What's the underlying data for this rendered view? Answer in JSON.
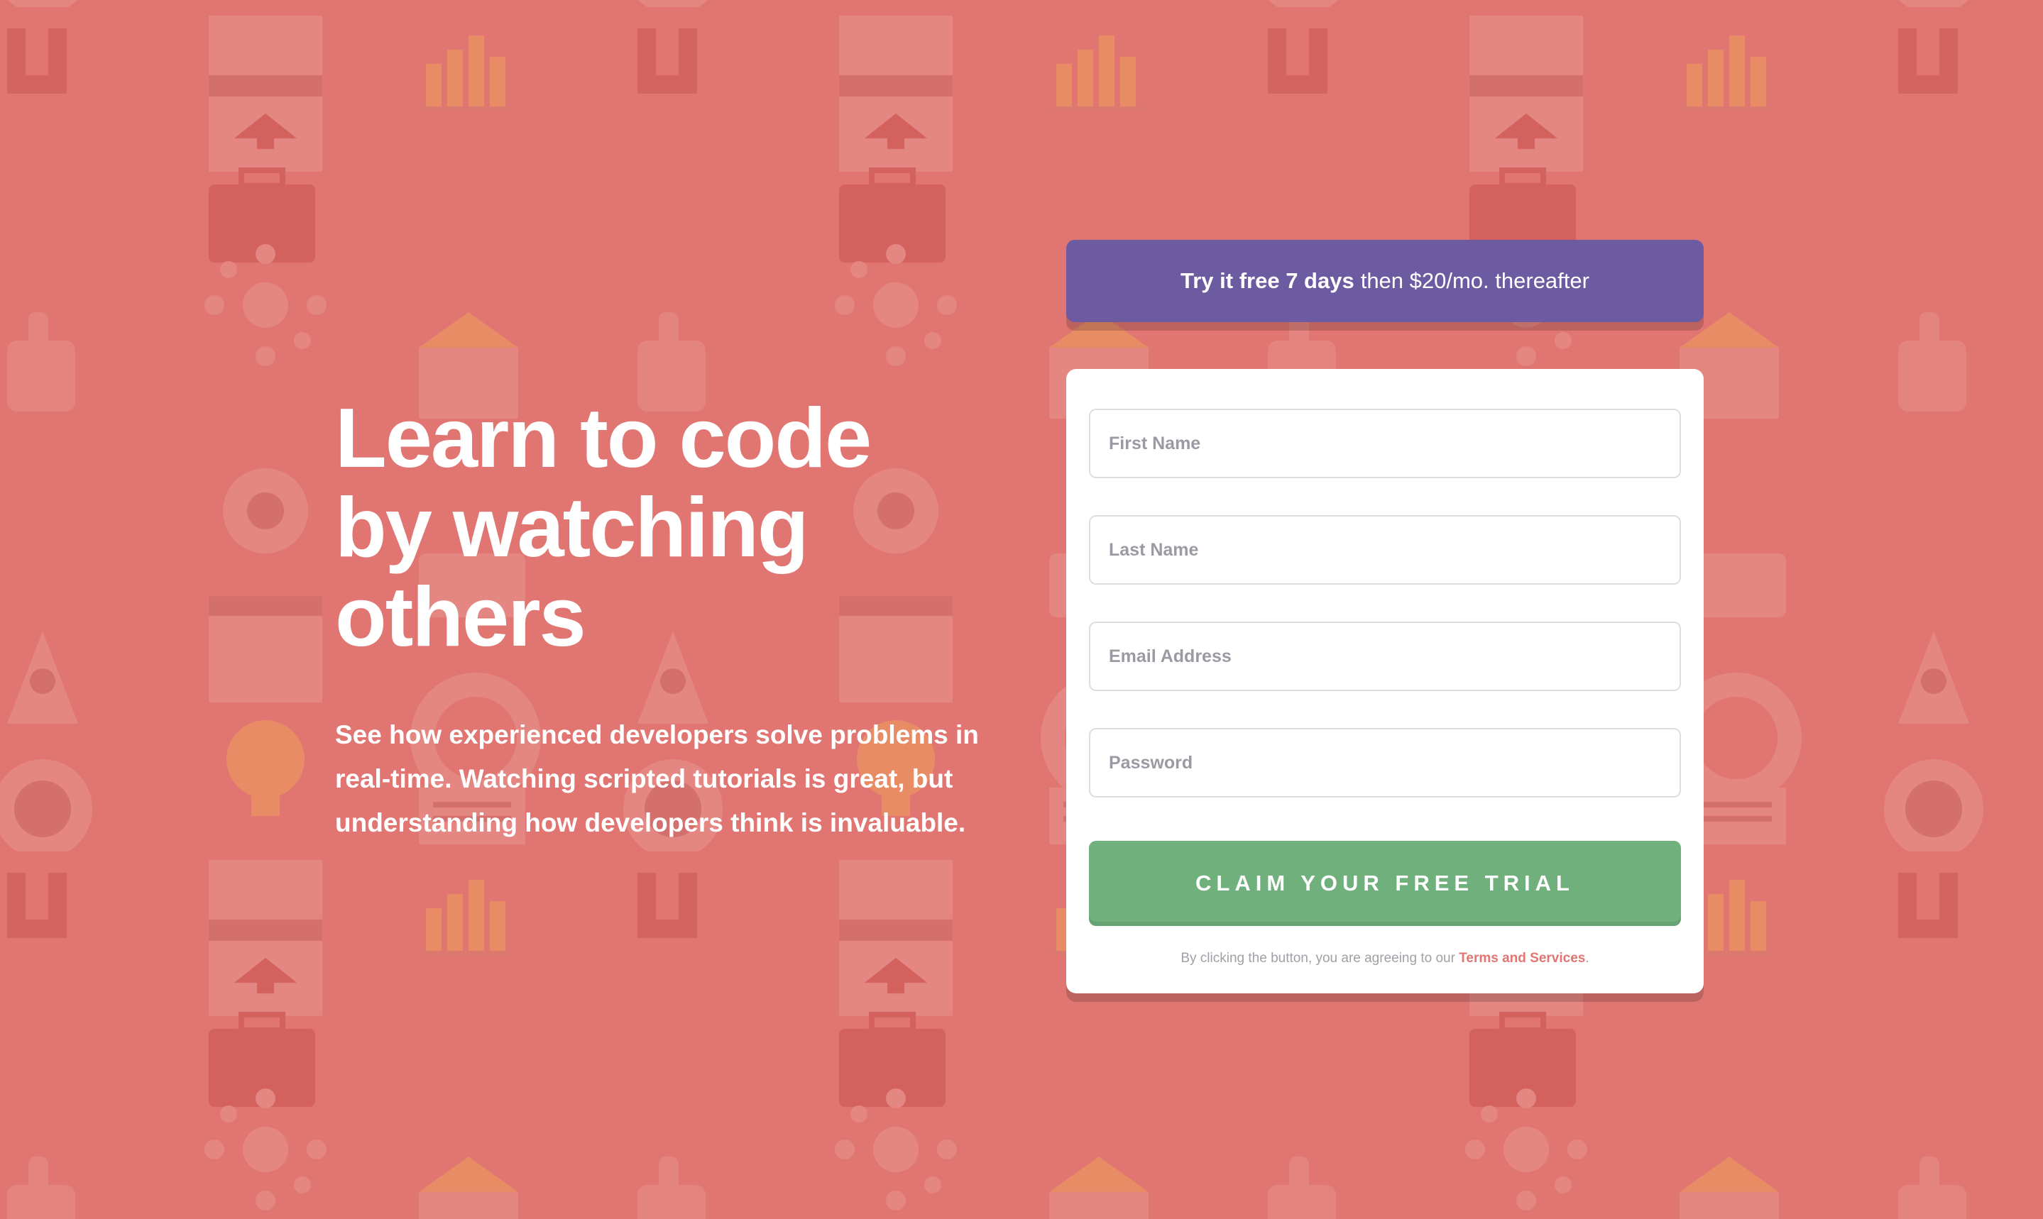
{
  "colors": {
    "background": "#e17572",
    "banner": "#6c5ba0",
    "button": "#6fb07c",
    "link": "#e17572",
    "card": "#ffffff"
  },
  "hero": {
    "headline": "Learn to code by watching others",
    "description": "See how experienced developers solve problems in real-time. Watching scripted tutorials is great, but understanding how developers think is invaluable."
  },
  "offer": {
    "highlight": "Try it free 7 days",
    "rest": "then $20/mo. thereafter"
  },
  "form": {
    "first_name_placeholder": "First Name",
    "last_name_placeholder": "Last Name",
    "email_placeholder": "Email Address",
    "password_placeholder": "Password",
    "submit_label": "Claim your free trial",
    "legal_prefix": "By clicking the button, you are agreeing to our",
    "legal_link": "Terms and Services",
    "legal_suffix": "."
  },
  "background_icons": [
    "browser-window-icon",
    "bar-chart-icon",
    "magnet-icon",
    "network-icon",
    "thumbs-up-icon",
    "gear-icon",
    "rocket-icon",
    "lightbulb-icon",
    "lifebuoy-icon",
    "calendar-icon",
    "toolbox-icon",
    "globe-icon"
  ]
}
